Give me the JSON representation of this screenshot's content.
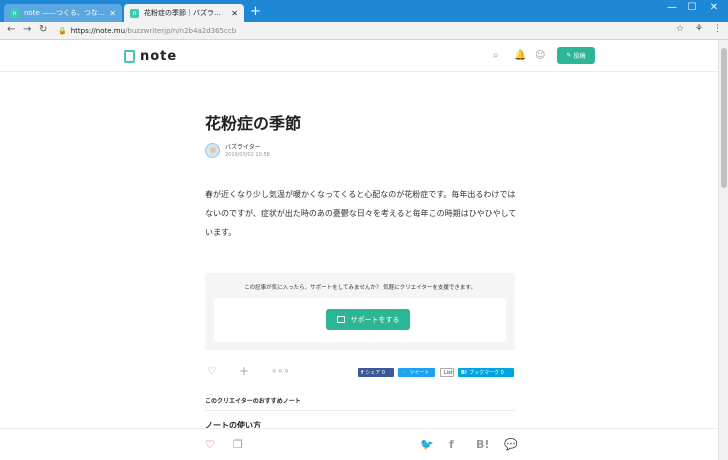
{
  "browser": {
    "tabs": [
      {
        "title": "note ——つくる、つながる、とどける。",
        "active": false
      },
      {
        "title": "花粉症の季節｜バズライター｜note",
        "active": true
      }
    ],
    "new_tab": "+",
    "window_controls": [
      "—",
      "☐",
      "✕"
    ],
    "url_host": "https://note.mu",
    "url_path": "/buzzwriterjp/n/n2b4a2d365ccb"
  },
  "header": {
    "logo_text": "note",
    "post_button": "投稿"
  },
  "article": {
    "title": "花粉症の季節",
    "author": "バズライター",
    "date": "2019/03/02 10:58",
    "body": "春が近くなり少し気温が暖かくなってくると心配なのが花粉症です。毎年出るわけではないのですが、症状が出た時のあの憂鬱な日々を考えると毎年この時期はひやひやしています。"
  },
  "support": {
    "message": "この記事が気に入ったら、サポートをしてみませんか？ 気軽にクリエイターを支援できます。",
    "button": "サポートをする"
  },
  "share": {
    "facebook": "シェア 0",
    "twitter": "ツイート",
    "list": "List",
    "hatena": "ブックマーク 0"
  },
  "recommend": {
    "heading": "このクリエイターのおすすめノート",
    "first_item": "ノートの使い方"
  },
  "colors": {
    "accent": "#2cb696",
    "chrome_blue": "#1e88d6",
    "heart": "#e0474c"
  }
}
